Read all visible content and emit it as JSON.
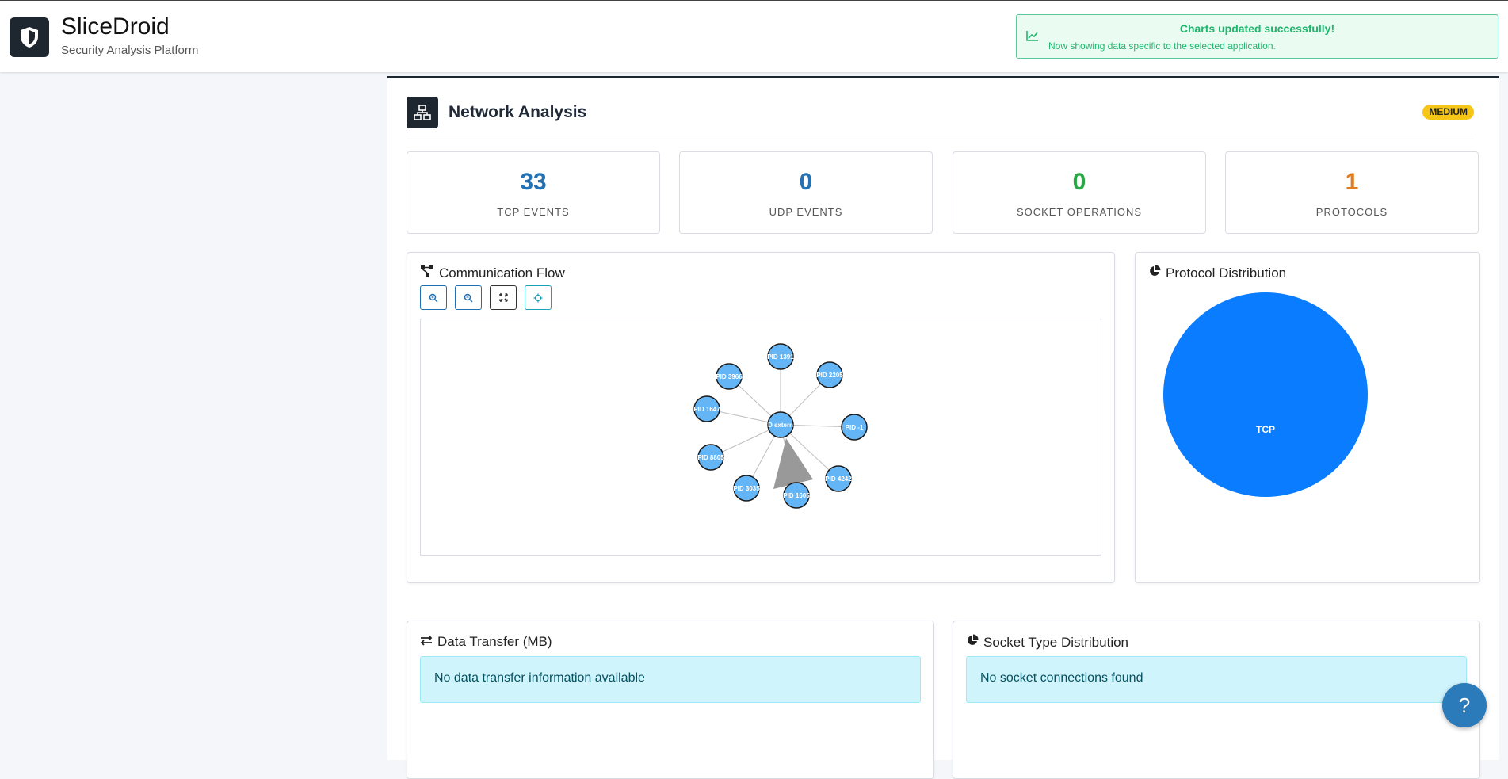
{
  "app": {
    "title": "SliceDroid",
    "subtitle": "Security Analysis Platform"
  },
  "toast": {
    "title": "Charts updated successfully!",
    "message": "Now showing data specific to the selected application."
  },
  "section": {
    "title": "Network Analysis",
    "badge": "MEDIUM"
  },
  "stats": [
    {
      "value": "33",
      "label": "TCP EVENTS",
      "color": "#2471b3"
    },
    {
      "value": "0",
      "label": "UDP EVENTS",
      "color": "#2471b3"
    },
    {
      "value": "0",
      "label": "SOCKET OPERATIONS",
      "color": "#28a745"
    },
    {
      "value": "1",
      "label": "PROTOCOLS",
      "color": "#e07b20"
    }
  ],
  "communication_flow": {
    "title": "Communication Flow",
    "controls": [
      "zoom-in",
      "zoom-out",
      "fit",
      "center"
    ],
    "center_node": "D extern",
    "nodes": [
      "PID 1391",
      "PID 2205",
      "PID -1",
      "PID 4242",
      "PID 1605",
      "PID 3035",
      "PID 8805",
      "PID 1647",
      "PID 3966"
    ],
    "node_color": "#64b5f6"
  },
  "protocol_distribution": {
    "title": "Protocol Distribution",
    "slice_label": "TCP",
    "slice_color": "#0a7cff"
  },
  "data_transfer": {
    "title": "Data Transfer (MB)",
    "empty_message": "No data transfer information available"
  },
  "socket_types": {
    "title": "Socket Type Distribution",
    "empty_message": "No socket connections found"
  },
  "help_button": "?"
}
